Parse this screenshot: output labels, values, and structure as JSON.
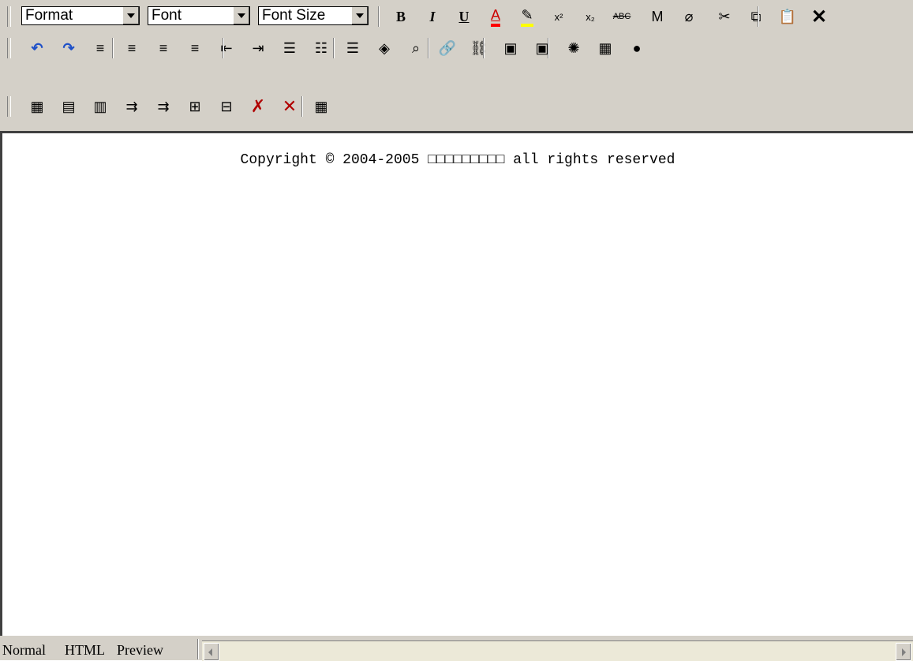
{
  "toolbar": {
    "format_label": "Format",
    "font_label": "Font",
    "fontsize_label": "Font Size",
    "row1": [
      {
        "name": "bold-icon",
        "glyph": "B"
      },
      {
        "name": "italic-icon",
        "glyph": "I"
      },
      {
        "name": "underline-icon",
        "glyph": "U"
      },
      {
        "name": "font-color-icon",
        "glyph": "A"
      },
      {
        "name": "highlight-icon",
        "glyph": "✎"
      },
      {
        "name": "superscript-icon",
        "glyph": "x²"
      },
      {
        "name": "subscript-icon",
        "glyph": "x₂"
      },
      {
        "name": "strikethrough-icon",
        "glyph": "ABC"
      },
      {
        "name": "marker-icon",
        "glyph": "M"
      },
      {
        "name": "eraser-icon",
        "glyph": "⌀"
      },
      {
        "name": "cut-icon",
        "glyph": "✂"
      },
      {
        "name": "copy-icon",
        "glyph": "⧉"
      },
      {
        "name": "paste-icon",
        "glyph": "📋"
      },
      {
        "name": "delete-icon",
        "glyph": "✕"
      }
    ],
    "row2": [
      {
        "name": "undo-icon",
        "glyph": "↶"
      },
      {
        "name": "redo-icon",
        "glyph": "↷"
      },
      {
        "name": "justify-icon",
        "glyph": "≡"
      },
      {
        "name": "align-left-icon",
        "glyph": "≡"
      },
      {
        "name": "align-center-icon",
        "glyph": "≡"
      },
      {
        "name": "align-right-icon",
        "glyph": "≡"
      },
      {
        "name": "outdent-icon",
        "glyph": "⇤"
      },
      {
        "name": "indent-icon",
        "glyph": "⇥"
      },
      {
        "name": "line-spacing-icon",
        "glyph": "☰"
      },
      {
        "name": "ordered-list-icon",
        "glyph": "☷"
      },
      {
        "name": "unordered-list-icon",
        "glyph": "☰"
      },
      {
        "name": "special-char-icon",
        "glyph": "◈"
      },
      {
        "name": "find-icon",
        "glyph": "⌕"
      },
      {
        "name": "link-icon",
        "glyph": "🔗"
      },
      {
        "name": "unlink-icon",
        "glyph": "⛓"
      },
      {
        "name": "image-icon",
        "glyph": "▣"
      },
      {
        "name": "image-props-icon",
        "glyph": "▣"
      },
      {
        "name": "flash-icon",
        "glyph": "✺"
      },
      {
        "name": "media-icon",
        "glyph": "▦"
      },
      {
        "name": "emoticon-icon",
        "glyph": "●"
      }
    ],
    "row3": [
      {
        "name": "insert-table-icon",
        "glyph": "▦"
      },
      {
        "name": "table-props-icon",
        "glyph": "▤"
      },
      {
        "name": "cell-props-icon",
        "glyph": "▥"
      },
      {
        "name": "insert-row-icon",
        "glyph": "⇉"
      },
      {
        "name": "insert-col-icon",
        "glyph": "⇉"
      },
      {
        "name": "merge-cells-icon",
        "glyph": "⊞"
      },
      {
        "name": "split-cells-icon",
        "glyph": "⊟"
      },
      {
        "name": "delete-row-icon",
        "glyph": "✗"
      },
      {
        "name": "delete-col-icon",
        "glyph": "✕"
      },
      {
        "name": "calculator-icon",
        "glyph": "▦"
      }
    ]
  },
  "editor": {
    "text": "Copyright © 2004-2005  □□□□□□□□□ all rights reserved"
  },
  "tabs": {
    "normal": "Normal",
    "html": "HTML",
    "preview": "Preview"
  },
  "colors": {
    "font_color_bar": "#ff0000",
    "highlight_bar": "#ffff00"
  }
}
